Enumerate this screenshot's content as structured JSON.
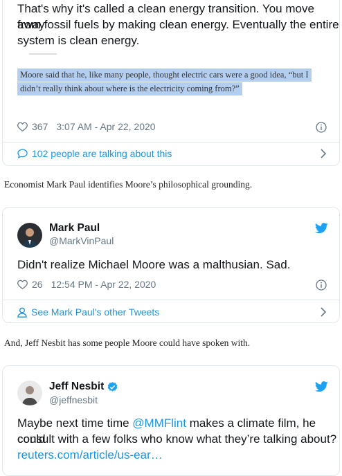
{
  "tweet1": {
    "text_line1": "That's why it's called a clean energy transition. You move away",
    "text_line2": "from fossil fuels by making clean energy. Eventually the entire",
    "text_line3": "system is clean energy.",
    "quote_line1": "Moore said that he, like many people, thought electric cars were a good idea, “but I",
    "quote_line2": "didn’t really think about where is the electricity coming from?”",
    "likes": "367",
    "timestamp": "3:07 AM - Apr 22, 2020",
    "footer": "102 people are talking about this"
  },
  "prose1": "Economist Mark Paul identifies Moore’s philosophical grounding.",
  "tweet2": {
    "name": "Mark Paul",
    "handle": "@MarkVinPaul",
    "text": "Didn't realize Michael Moore was a malthusian. Sad.",
    "likes": "26",
    "timestamp": "12:54 PM - Apr 22, 2020",
    "footer": "See Mark Paul's other Tweets"
  },
  "prose2": "And, Jeff Nesbit has some people Moore could have spoken with.",
  "tweet3": {
    "name": "Jeff Nesbit",
    "handle": "@jeffnesbit",
    "text_pre": "Maybe next time time ",
    "mention": "@MMFlint",
    "text_post": " makes a climate film, he could",
    "text_line2": "consult with a few folks who know what they’re talking about?",
    "link": "reuters.com/article/us-ear…"
  },
  "colors": {
    "accent": "#1b95e0",
    "muted": "#657786",
    "highlight": "#b4cef0",
    "verified": "#1da1f2"
  }
}
